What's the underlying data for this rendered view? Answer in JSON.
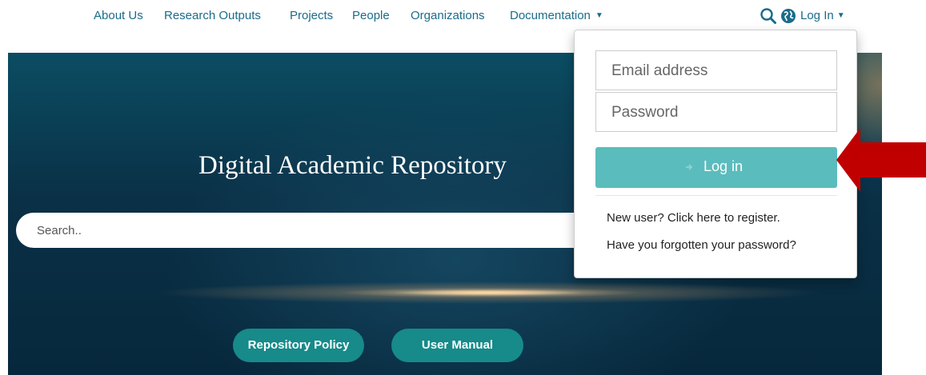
{
  "nav": {
    "items": [
      {
        "label": "About Us"
      },
      {
        "label": "Research Outputs"
      },
      {
        "label": "Projects"
      },
      {
        "label": "People"
      },
      {
        "label": "Organizations"
      },
      {
        "label": "Documentation"
      }
    ],
    "login_label": "Log In",
    "icons": [
      "search-icon",
      "globe-icon",
      "caret-down-icon"
    ]
  },
  "hero": {
    "title": "Digital Academic Repository",
    "search_placeholder": "Search..",
    "buttons": [
      {
        "label": "Repository Policy"
      },
      {
        "label": "User Manual"
      }
    ]
  },
  "login_dropdown": {
    "email_placeholder": "Email address",
    "password_placeholder": "Password",
    "submit_label": "Log in",
    "register_link": "New user? Click here to register.",
    "forgot_link": "Have you forgotten your password?"
  },
  "colors": {
    "link": "#1a6c8a",
    "button_teal": "#178a8a",
    "login_button": "#5bbcbd",
    "arrow_red": "#c00000"
  }
}
